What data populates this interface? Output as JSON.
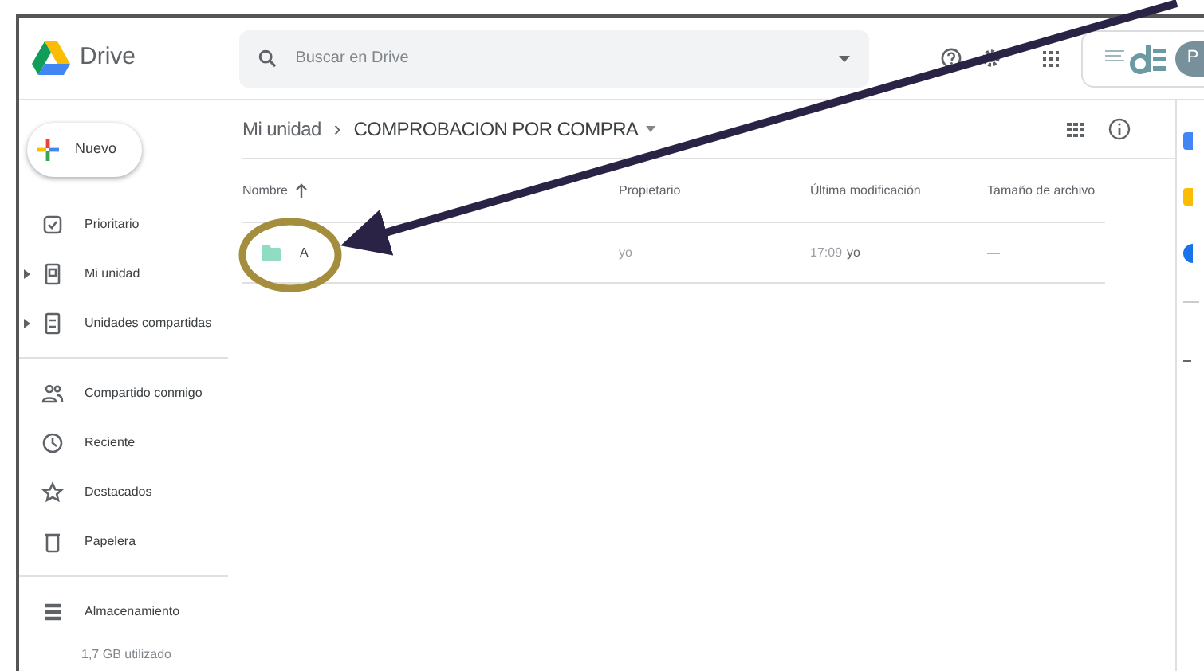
{
  "app": {
    "name": "Drive"
  },
  "search": {
    "placeholder": "Buscar en Drive"
  },
  "account": {
    "initial": "P"
  },
  "new_button": {
    "label": "Nuevo"
  },
  "sidebar": {
    "sections": [
      [
        {
          "label": "Prioritario",
          "kind": "priority",
          "expandable": false
        },
        {
          "label": "Mi unidad",
          "kind": "drive",
          "expandable": true
        },
        {
          "label": "Unidades compartidas",
          "kind": "shared",
          "expandable": true
        }
      ],
      [
        {
          "label": "Compartido conmigo",
          "kind": "people",
          "expandable": false
        },
        {
          "label": "Reciente",
          "kind": "clock",
          "expandable": false
        },
        {
          "label": "Destacados",
          "kind": "star",
          "expandable": false
        },
        {
          "label": "Papelera",
          "kind": "trash",
          "expandable": false
        }
      ],
      [
        {
          "label": "Almacenamiento",
          "kind": "storage",
          "expandable": false
        }
      ]
    ],
    "storage_used": "1,7 GB utilizado"
  },
  "breadcrumb": {
    "parent": "Mi unidad",
    "separator": "›",
    "current": "COMPROBACION POR COMPRA"
  },
  "table": {
    "columns": [
      "Nombre",
      "Propietario",
      "Última modificación",
      "Tamaño de archivo"
    ],
    "rows": [
      {
        "name": "A",
        "owner": "yo",
        "modified_time": "17:09",
        "modified_by": "yo",
        "size": "—"
      }
    ]
  }
}
